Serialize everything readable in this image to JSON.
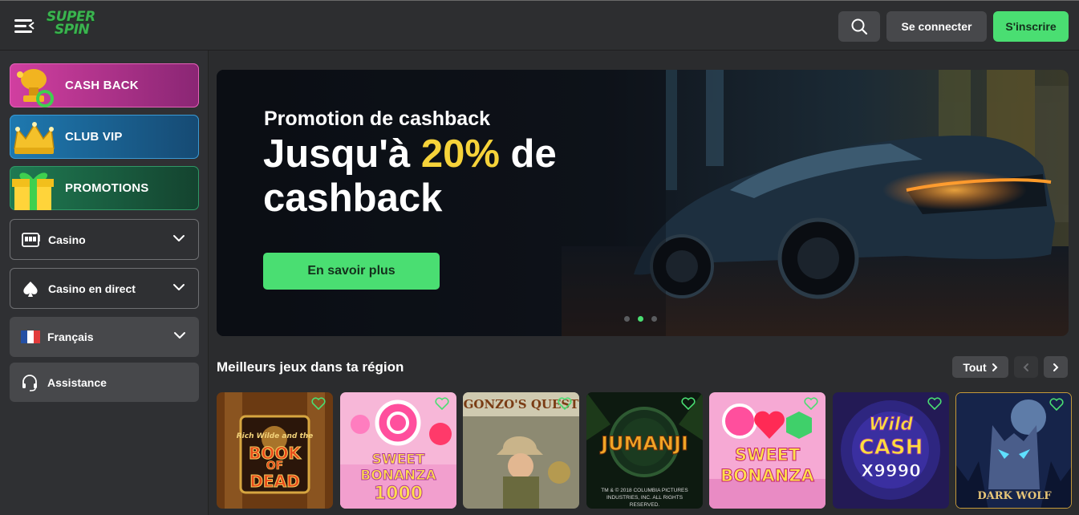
{
  "header": {
    "logo_line1": "SUPER",
    "logo_line2": "SPIN",
    "login_label": "Se connecter",
    "signup_label": "S'inscrire"
  },
  "sidebar": {
    "promos": [
      {
        "label": "CASH BACK",
        "icon": "cashback-trophy-icon",
        "color_from": "#d13fa0",
        "color_to": "#7a1f65"
      },
      {
        "label": "CLUB VIP",
        "icon": "crown-icon",
        "color_from": "#1e79b0",
        "color_to": "#123e61"
      },
      {
        "label": "PROMOTIONS",
        "icon": "gift-icon",
        "color_from": "#1f7a52",
        "color_to": "#113a2b"
      }
    ],
    "nav": [
      {
        "label": "Casino",
        "icon": "slot-machine-icon"
      },
      {
        "label": "Casino en direct",
        "icon": "spade-icon"
      },
      {
        "label": "Français",
        "icon": "france-flag-icon"
      },
      {
        "label": "Assistance",
        "icon": "headset-icon"
      }
    ]
  },
  "banner": {
    "kicker": "Promotion de cashback",
    "headline_pre": "Jusqu'à ",
    "headline_highlight": "20%",
    "headline_post": " de cashback",
    "cta": "En savoir plus",
    "active_slide": 2,
    "slide_count": 3
  },
  "games_section": {
    "title": "Meilleurs jeux dans ta région",
    "all_label": "Tout",
    "games": [
      {
        "name": "Book of Dead",
        "line1": "BOOK",
        "line2": "OF",
        "line3": "DEAD",
        "small": "Rich Wilde and the"
      },
      {
        "name": "Sweet Bonanza 1000",
        "line1": "SWEET",
        "line2": "BONANZA",
        "line3": "1000"
      },
      {
        "name": "Gonzo's Quest",
        "line1": "GONZO'S QUEST"
      },
      {
        "name": "Jumanji",
        "line1": "JUMANJI",
        "small": "TM & © 2018 COLUMBIA PICTURES INDUSTRIES, INC. ALL RIGHTS RESERVED."
      },
      {
        "name": "Sweet Bonanza",
        "line1": "SWEET",
        "line2": "BONANZA"
      },
      {
        "name": "Wild Cash x9990",
        "line1": "Wild",
        "line2": "CASH",
        "line3": "X9990"
      },
      {
        "name": "Dark Wolf",
        "line1": "DARK WOLF"
      }
    ]
  },
  "colors": {
    "accent_green": "#4ade72",
    "highlight_yellow": "#f6d33a"
  }
}
